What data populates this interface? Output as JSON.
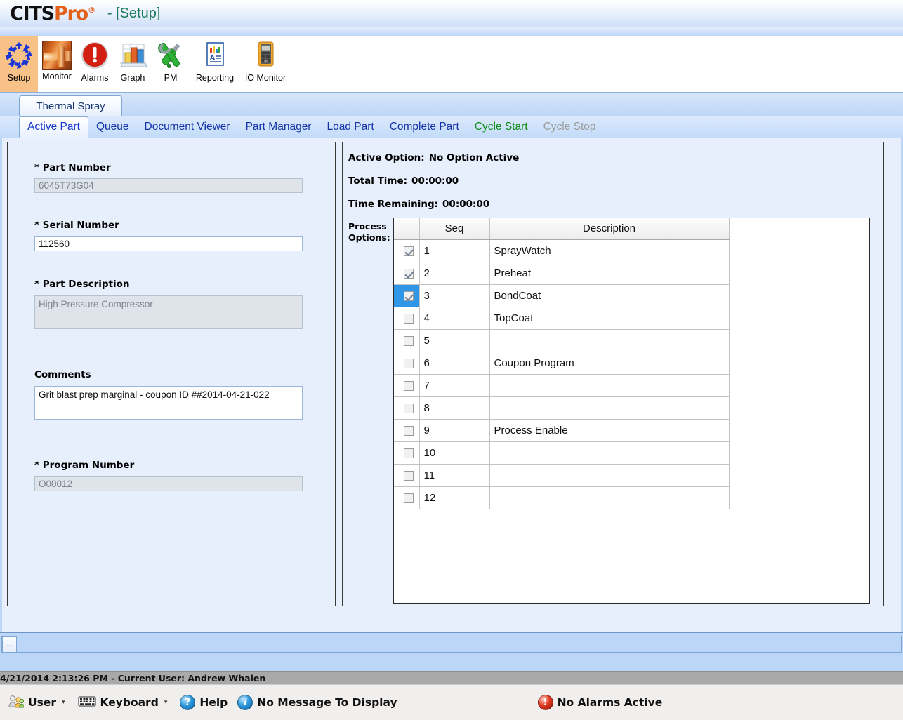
{
  "titlebar": {
    "logo_cits": "CITS",
    "logo_pro": "Pro",
    "logo_reg": "®",
    "window_title": "- [Setup]",
    "title_color": "#1f7a5a"
  },
  "toolbar": {
    "buttons": [
      {
        "label": "Setup",
        "icon": "setup-cycle-icon",
        "selected": true
      },
      {
        "label": "Monitor",
        "icon": "spray-gun-icon",
        "selected": false
      },
      {
        "label": "Alarms",
        "icon": "alarm-exclamation-icon",
        "selected": false
      },
      {
        "label": "Graph",
        "icon": "bar-chart-icon",
        "selected": false
      },
      {
        "label": "PM",
        "icon": "tools-wrench-icon",
        "selected": false
      },
      {
        "label": "Reporting",
        "icon": "report-document-icon",
        "selected": false
      },
      {
        "label": "IO Monitor",
        "icon": "multimeter-icon",
        "selected": false
      }
    ],
    "selected_bg": "#F7C188"
  },
  "outer_tabs": [
    {
      "label": "Thermal Spray",
      "active": true
    }
  ],
  "inner_tabs": [
    {
      "label": "Active Part",
      "state": "active"
    },
    {
      "label": "Queue",
      "state": "normal"
    },
    {
      "label": "Document Viewer",
      "state": "normal"
    },
    {
      "label": "Part Manager",
      "state": "normal"
    },
    {
      "label": "Load Part",
      "state": "normal"
    },
    {
      "label": "Complete Part",
      "state": "normal"
    },
    {
      "label": "Cycle Start",
      "state": "green"
    },
    {
      "label": "Cycle Stop",
      "state": "dimmed"
    }
  ],
  "left_panel": {
    "part_number": {
      "label": "* Part Number",
      "value": "6045T73G04",
      "readonly": true
    },
    "serial_number": {
      "label": "* Serial Number",
      "value": "112560",
      "readonly": false
    },
    "part_description": {
      "label": "* Part Description",
      "value": "High Pressure Compressor",
      "readonly": true
    },
    "comments": {
      "label": "Comments",
      "value": "Grit blast prep marginal - coupon ID ##2014-04-21-022",
      "readonly": false
    },
    "program_number": {
      "label": "* Program Number",
      "value": "O00012",
      "readonly": true
    }
  },
  "right_panel": {
    "active_option_label": "Active Option:",
    "active_option_value": "No Option Active",
    "total_time_label": "Total Time:",
    "total_time_value": "00:00:00",
    "time_remaining_label": "Time Remaining:",
    "time_remaining_value": "00:00:00",
    "process_options_label": "Process\nOptions:",
    "grid": {
      "columns": [
        "",
        "Seq",
        "Description"
      ],
      "selected_row_index": 2,
      "rows": [
        {
          "checked": true,
          "seq": "1",
          "description": "SprayWatch"
        },
        {
          "checked": true,
          "seq": "2",
          "description": "Preheat"
        },
        {
          "checked": true,
          "seq": "3",
          "description": "BondCoat"
        },
        {
          "checked": false,
          "seq": "4",
          "description": "TopCoat"
        },
        {
          "checked": false,
          "seq": "5",
          "description": ""
        },
        {
          "checked": false,
          "seq": "6",
          "description": "Coupon Program"
        },
        {
          "checked": false,
          "seq": "7",
          "description": ""
        },
        {
          "checked": false,
          "seq": "8",
          "description": ""
        },
        {
          "checked": false,
          "seq": "9",
          "description": "Process Enable"
        },
        {
          "checked": false,
          "seq": "10",
          "description": ""
        },
        {
          "checked": false,
          "seq": "11",
          "description": ""
        },
        {
          "checked": false,
          "seq": "12",
          "description": ""
        }
      ]
    },
    "selection_color": "#2f96e8"
  },
  "bottom_strip": {
    "mini_tab_label": "..."
  },
  "status_bar": {
    "datetime_user": "4/21/2014 2:13:26 PM - Current User:  Andrew Whalen",
    "user_label": "User",
    "keyboard_label": "Keyboard",
    "help_label": "Help",
    "message": "No Message To Display",
    "alarm_text": "No Alarms Active",
    "alarm_color": "#d03a1c"
  }
}
